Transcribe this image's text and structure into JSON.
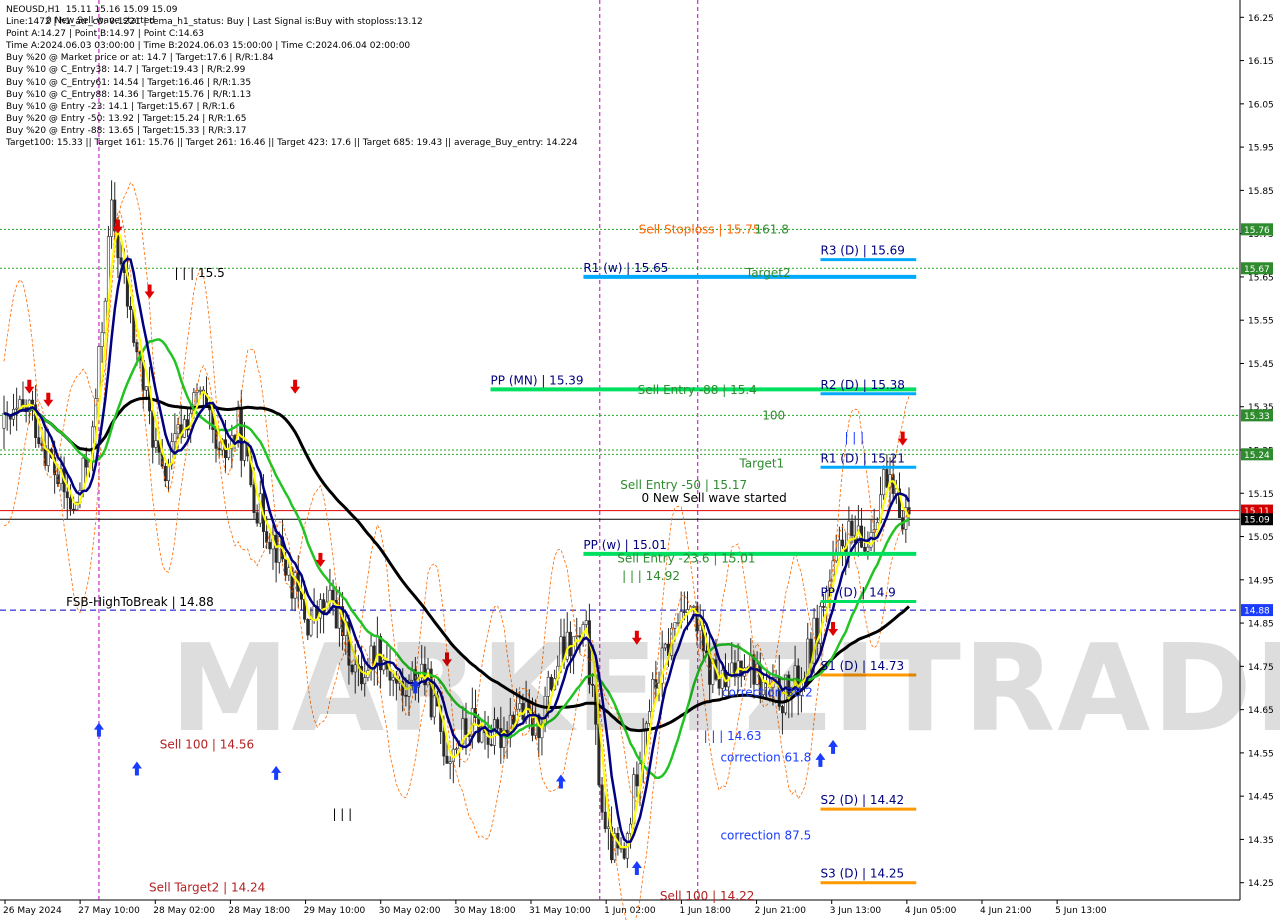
{
  "header": {
    "symbol_line": "NEOUSD,H1  15.11 15.16 15.09 15.09",
    "lines": [
      "Line:1472 | h1_atr_c0: 0.1221 | tema_h1_status: Buy | Last Signal is:Buy with stoploss:13.12",
      "Point A:14.27 | Point B:14.97 | Point C:14.63",
      "Time A:2024.06.03 03:00:00 | Time B:2024.06.03 15:00:00 | Time C:2024.06.04 02:00:00",
      "Buy %20 @ Market price or at: 14.7 | Target:17.6 | R/R:1.84",
      "Buy %10 @ C_Entry38: 14.7 | Target:19.43 | R/R:2.99",
      "Buy %10 @ C_Entry61: 14.54 | Target:16.46 | R/R:1.35",
      "Buy %10 @ C_Entry88: 14.36 | Target:15.76 | R/R:1.13",
      "Buy %10 @ Entry -23: 14.1 | Target:15.67 | R/R:1.6",
      "Buy %20 @ Entry -50: 13.92 | Target:15.24 | R/R:1.65",
      "Buy %20 @ Entry -88: 13.65 | Target:15.33 | R/R:3.17",
      "Target100: 15.33 || Target 161: 15.76 || Target 261: 16.46 || Target 423: 17.6 || Target 685: 19.43 || average_Buy_entry: 14.224"
    ],
    "wave_label": "0 New Sell wave started"
  },
  "watermark": "MARKETZITRADE",
  "colors": {
    "bg": "#ffffff",
    "grid": "#c8c8c8",
    "bull": "#2a2a2a",
    "bear": "#2a2a2a",
    "ma_black": "#000000",
    "ma_green": "#22c322",
    "ma_navy": "#000080",
    "ma_yellow": "#ffff00",
    "envelope": "#ff6a00",
    "level_green": "#22aa22",
    "level_blue": "#0000cc",
    "level_red": "#dd0000",
    "pivot_blue": "#00aaff",
    "pivot_green": "#00e060",
    "pivot_orange": "#ff9900",
    "magenta": "#c000c0",
    "axis_green": "#2e8b2e",
    "axis_blue": "#1a3cff",
    "axis_red": "#d00000",
    "axis_black": "#000000"
  },
  "chart_data": {
    "type": "candlestick",
    "symbol": "NEOUSD",
    "timeframe": "H1",
    "ylim": [
      14.21,
      16.29
    ],
    "y_ticks": [
      14.25,
      14.35,
      14.45,
      14.55,
      14.65,
      14.75,
      14.85,
      14.95,
      15.05,
      15.15,
      15.25,
      15.35,
      15.45,
      15.55,
      15.65,
      15.75,
      15.85,
      15.95,
      16.05,
      16.15,
      16.25
    ],
    "y_tick_labels": [
      "14.25",
      "14.35",
      "14.45",
      "14.55",
      "14.65",
      "14.75",
      "14.85",
      "14.95",
      "15.05",
      "15.15",
      "15.25",
      "15.35",
      "15.45",
      "15.55",
      "15.65",
      "15.75",
      "15.85",
      "15.95",
      "16.05",
      "16.15",
      "16.25"
    ],
    "x_tick_labels": [
      "26 May 2024",
      "27 May 10:00",
      "28 May 02:00",
      "28 May 18:00",
      "29 May 10:00",
      "30 May 02:00",
      "30 May 18:00",
      "31 May 10:00",
      "1 Jun 02:00",
      "1 Jun 18:00",
      "2 Jun 21:00",
      "3 Jun 13:00",
      "4 Jun 05:00",
      "4 Jun 21:00",
      "5 Jun 13:00"
    ],
    "x_tick_fractions": [
      0.0,
      0.0606,
      0.1212,
      0.1818,
      0.2424,
      0.303,
      0.3636,
      0.4242,
      0.4848,
      0.5455,
      0.6061,
      0.6667,
      0.7273,
      0.7879,
      0.8485
    ],
    "axis_labels": [
      {
        "value": 15.76,
        "text": "15.76",
        "color": "axis_green"
      },
      {
        "value": 15.67,
        "text": "15.67",
        "color": "axis_green"
      },
      {
        "value": 15.33,
        "text": "15.33",
        "color": "axis_green"
      },
      {
        "value": 15.24,
        "text": "15.24",
        "color": "axis_green"
      },
      {
        "value": 15.11,
        "text": "15.11",
        "color": "axis_red"
      },
      {
        "value": 15.09,
        "text": "15.09",
        "color": "axis_black"
      },
      {
        "value": 14.88,
        "text": "14.88",
        "color": "axis_blue"
      }
    ],
    "horizontal_levels": [
      {
        "value": 15.76,
        "style": "dotted",
        "color": "level_green"
      },
      {
        "value": 15.67,
        "style": "dotted",
        "color": "level_green"
      },
      {
        "value": 15.33,
        "style": "dotted",
        "color": "level_green"
      },
      {
        "value": 15.25,
        "style": "dotted",
        "color": "level_green"
      },
      {
        "value": 15.24,
        "style": "dotted",
        "color": "level_green"
      },
      {
        "value": 15.11,
        "style": "solid",
        "color": "level_red"
      },
      {
        "value": 15.09,
        "style": "solid",
        "color": "axis_black"
      },
      {
        "value": 14.88,
        "style": "dashed",
        "color": "level_blue"
      }
    ],
    "pivots": [
      {
        "label": "R1 (w) | 15.65",
        "value": 15.65,
        "x0": 0.4705,
        "x1": 0.7147,
        "color": "pivot_blue",
        "weight": 4
      },
      {
        "label": "PP (MN) | 15.39",
        "value": 15.39,
        "x0": 0.3956,
        "x1": 0.7147,
        "color": "pivot_green",
        "weight": 4
      },
      {
        "label": "PP (w) | 15.01",
        "value": 15.01,
        "x0": 0.4705,
        "x1": 0.7147,
        "color": "pivot_green",
        "weight": 4
      },
      {
        "label": "R3 (D) | 15.69",
        "value": 15.69,
        "x0": 0.6617,
        "x1": 0.7147,
        "color": "pivot_blue",
        "weight": 3
      },
      {
        "label": "R2 (D) | 15.38",
        "value": 15.38,
        "x0": 0.6617,
        "x1": 0.7147,
        "color": "pivot_blue",
        "weight": 3
      },
      {
        "label": "R1 (D) | 15.21",
        "value": 15.21,
        "x0": 0.6617,
        "x1": 0.7147,
        "color": "pivot_blue",
        "weight": 3
      },
      {
        "label": "PP (D) | 14.9",
        "value": 14.9,
        "x0": 0.6617,
        "x1": 0.7147,
        "color": "pivot_green",
        "weight": 3
      },
      {
        "label": "S1 (D) | 14.73",
        "value": 14.73,
        "x0": 0.6617,
        "x1": 0.7147,
        "color": "pivot_orange",
        "weight": 3
      },
      {
        "label": "S2 (D) | 14.42",
        "value": 14.42,
        "x0": 0.6617,
        "x1": 0.7147,
        "color": "pivot_orange",
        "weight": 3
      },
      {
        "label": "S3 (D) | 14.25",
        "value": 14.25,
        "x0": 0.6617,
        "x1": 0.7147,
        "color": "pivot_orange",
        "weight": 3
      }
    ],
    "vertical_markers": [
      {
        "x": 0.0798,
        "color": "magenta"
      },
      {
        "x": 0.4837,
        "color": "magenta"
      },
      {
        "x": 0.5627,
        "color": "magenta"
      }
    ],
    "annotations": [
      {
        "text": "Sell Stoploss | 15.75",
        "x": 0.515,
        "value": 15.75,
        "color": "#ff6600"
      },
      {
        "text": "161.8",
        "x": 0.6085,
        "value": 15.75,
        "color": "#2e8b2e"
      },
      {
        "text": "Target2",
        "x": 0.6015,
        "value": 15.65,
        "color": "#2e8b2e"
      },
      {
        "text": "Sell Entry -88 | 15.4",
        "x": 0.5142,
        "value": 15.38,
        "color": "#2e8b2e"
      },
      {
        "text": "100",
        "x": 0.6147,
        "value": 15.32,
        "color": "#2e8b2e"
      },
      {
        "text": "Target1",
        "x": 0.5963,
        "value": 15.21,
        "color": "#2e8b2e"
      },
      {
        "text": "Sell Entry -50 | 15.17",
        "x": 0.5002,
        "value": 15.16,
        "color": "#2e8b2e"
      },
      {
        "text": "0 New Sell wave started",
        "x": 0.5173,
        "value": 15.13,
        "color": "#000000"
      },
      {
        "text": "Sell Entry -23.6 | 15.01",
        "x": 0.4978,
        "value": 14.99,
        "color": "#2e8b2e"
      },
      {
        "text": "| | | 14.92",
        "x": 0.5017,
        "value": 14.95,
        "color": "#2e8b2e"
      },
      {
        "text": "| | | 15.5",
        "x": 0.1407,
        "value": 15.65,
        "color": "#000000"
      },
      {
        "text": "FSB-HighToBreak | 14.88",
        "x": 0.0533,
        "value": 14.89,
        "color": "#000000"
      },
      {
        "text": "Sell 100 | 14.56",
        "x": 0.1288,
        "value": 14.56,
        "color": "#b22222"
      },
      {
        "text": "Sell Target2 | 14.24",
        "x": 0.1202,
        "value": 14.23,
        "color": "#b22222"
      },
      {
        "text": "Sell 100 | 14.22",
        "x": 0.5322,
        "value": 14.21,
        "color": "#b22222"
      },
      {
        "text": "correction 38.2",
        "x": 0.5822,
        "value": 14.68,
        "color": "#1a3cff"
      },
      {
        "text": "| | | 14.63",
        "x": 0.5674,
        "value": 14.58,
        "color": "#1a3cff"
      },
      {
        "text": "correction 61.8",
        "x": 0.581,
        "value": 14.53,
        "color": "#1a3cff"
      },
      {
        "text": "correction 87.5",
        "x": 0.581,
        "value": 14.35,
        "color": "#1a3cff"
      },
      {
        "text": "| | |",
        "x": 0.681,
        "value": 15.27,
        "color": "#1a3cff"
      },
      {
        "text": "| | |",
        "x": 0.2681,
        "value": 14.4,
        "color": "#000000"
      }
    ],
    "candles": [],
    "note": "Candles and moving averages are rendered from a generated approximation of the visible price path."
  }
}
